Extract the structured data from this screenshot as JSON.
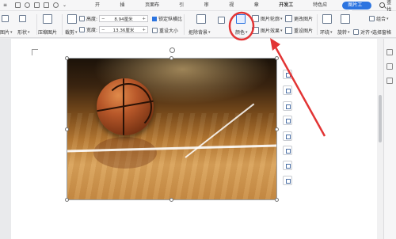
{
  "menu": {
    "tabs": [
      "开始",
      "插入",
      "页面布局",
      "引用",
      "审阅",
      "视图",
      "章节",
      "开发工具",
      "特色应用",
      "图片工具"
    ],
    "active_tab": "图片工具",
    "search_label": "查找"
  },
  "ribbon": {
    "g1_a": "图片",
    "g1_b": "形状",
    "compress": "压缩图片",
    "crop": "裁剪",
    "height_label": "高度:",
    "height_value": "8.94厘米",
    "width_label": "宽度:",
    "width_value": "13.36厘米",
    "lock_ratio": "锁定纵横比",
    "reset_size": "重设大小",
    "cutout": "抠除背景",
    "color": "颜色",
    "outline": "图片轮廓",
    "effects": "图片效果",
    "change_pic": "更改图片",
    "reset_pic": "重设图片",
    "wrap": "环绕",
    "rotate": "旋转",
    "align": "对齐",
    "combine": "组合",
    "select_pane": "选择窗格",
    "move_up": "上移"
  },
  "accent": "#2c74e0",
  "annotation_color": "#e23434"
}
